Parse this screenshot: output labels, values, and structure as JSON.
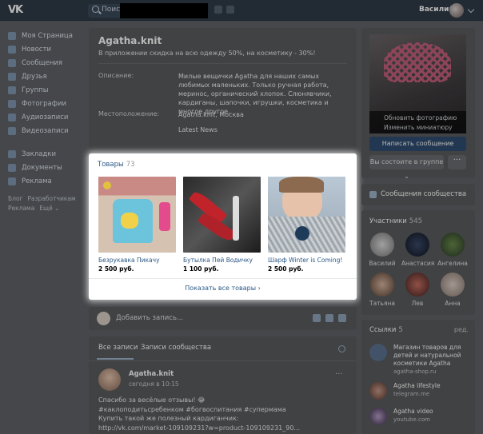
{
  "topbar": {
    "logo": "VK",
    "search_placeholder": "Поиск",
    "user_name": "Василий"
  },
  "nav": {
    "items": [
      {
        "label": "Моя Страница",
        "icon": "home-icon"
      },
      {
        "label": "Новости",
        "icon": "news-icon"
      },
      {
        "label": "Сообщения",
        "icon": "messages-icon"
      },
      {
        "label": "Друзья",
        "icon": "friends-icon"
      },
      {
        "label": "Группы",
        "icon": "groups-icon"
      },
      {
        "label": "Фотографии",
        "icon": "photos-icon"
      },
      {
        "label": "Аудиозаписи",
        "icon": "audio-icon"
      },
      {
        "label": "Видеозаписи",
        "icon": "video-icon"
      }
    ],
    "items2": [
      {
        "label": "Закладки",
        "icon": "star-icon"
      },
      {
        "label": "Документы",
        "icon": "document-icon"
      },
      {
        "label": "Реклама",
        "icon": "ads-icon"
      }
    ],
    "footer": {
      "blog": "Блог",
      "developers": "Разработчикам",
      "ads": "Реклама",
      "more": "Ещё ⌄"
    }
  },
  "profile": {
    "name": "Agatha.knit",
    "status": "В приложении скидка на всю одежду 50%, на косметику - 30%!",
    "description_label": "Описание:",
    "description": "Милые вещички Agatha для наших самых любимых маленьких. Только ручная работа, меринос, органический хлопок. Слюнявчики, кардиганы, шапочки, игрушки, косметика и многое другое.",
    "location_label": "Местоположение:",
    "location": "Agatha.knit, Москва",
    "latest_news": "Latest News"
  },
  "goods": {
    "title": "Товары",
    "count": "73",
    "items": [
      {
        "name": "Безрукавка Пикачу",
        "price": "2 500 руб."
      },
      {
        "name": "Бутылка Пей Водичку",
        "price": "1 100 руб."
      },
      {
        "name": "Шарф Winter is Coming!",
        "price": "2 500 руб."
      }
    ],
    "show_all": "Показать все товары ›"
  },
  "post_box": {
    "placeholder": "Добавить запись..."
  },
  "wall": {
    "tab_all": "Все записи",
    "tab_community": "Записи сообщества",
    "post": {
      "author": "Agatha.knit",
      "time": "сегодня в 10:15",
      "lines": [
        "Спасибо за весёлые отзывы! 😂",
        "#каклоподитьсребенком #богвоспитания #супермама",
        "Купить такой же полезный кардиганчик:",
        "http://vk.com/market-109109231?w=product-109109231_90..."
      ]
    }
  },
  "right": {
    "avatar_menu": [
      "Обновить фотографию",
      "Изменить миниатюру"
    ],
    "send_message": "Написать сообщение",
    "in_group": "Вы состоите в группе ⌄",
    "more": "···",
    "community_messages": "Сообщения сообщества",
    "members_title": "Участники",
    "members_count": "545",
    "members": [
      "Василий",
      "Анастасия",
      "Ангелина",
      "Татьяна",
      "Лев",
      "Анна"
    ],
    "links_title": "Ссылки",
    "links_count": "5",
    "links_edit": "ред.",
    "links": [
      {
        "title": "Магазин товаров для детей и натуральной косметики Agatha",
        "sub": "agatha-shop.ru"
      },
      {
        "title": "Agatha lifestyle",
        "sub": "telegram.me"
      },
      {
        "title": "Agatha video",
        "sub": "youtube.com"
      }
    ]
  }
}
